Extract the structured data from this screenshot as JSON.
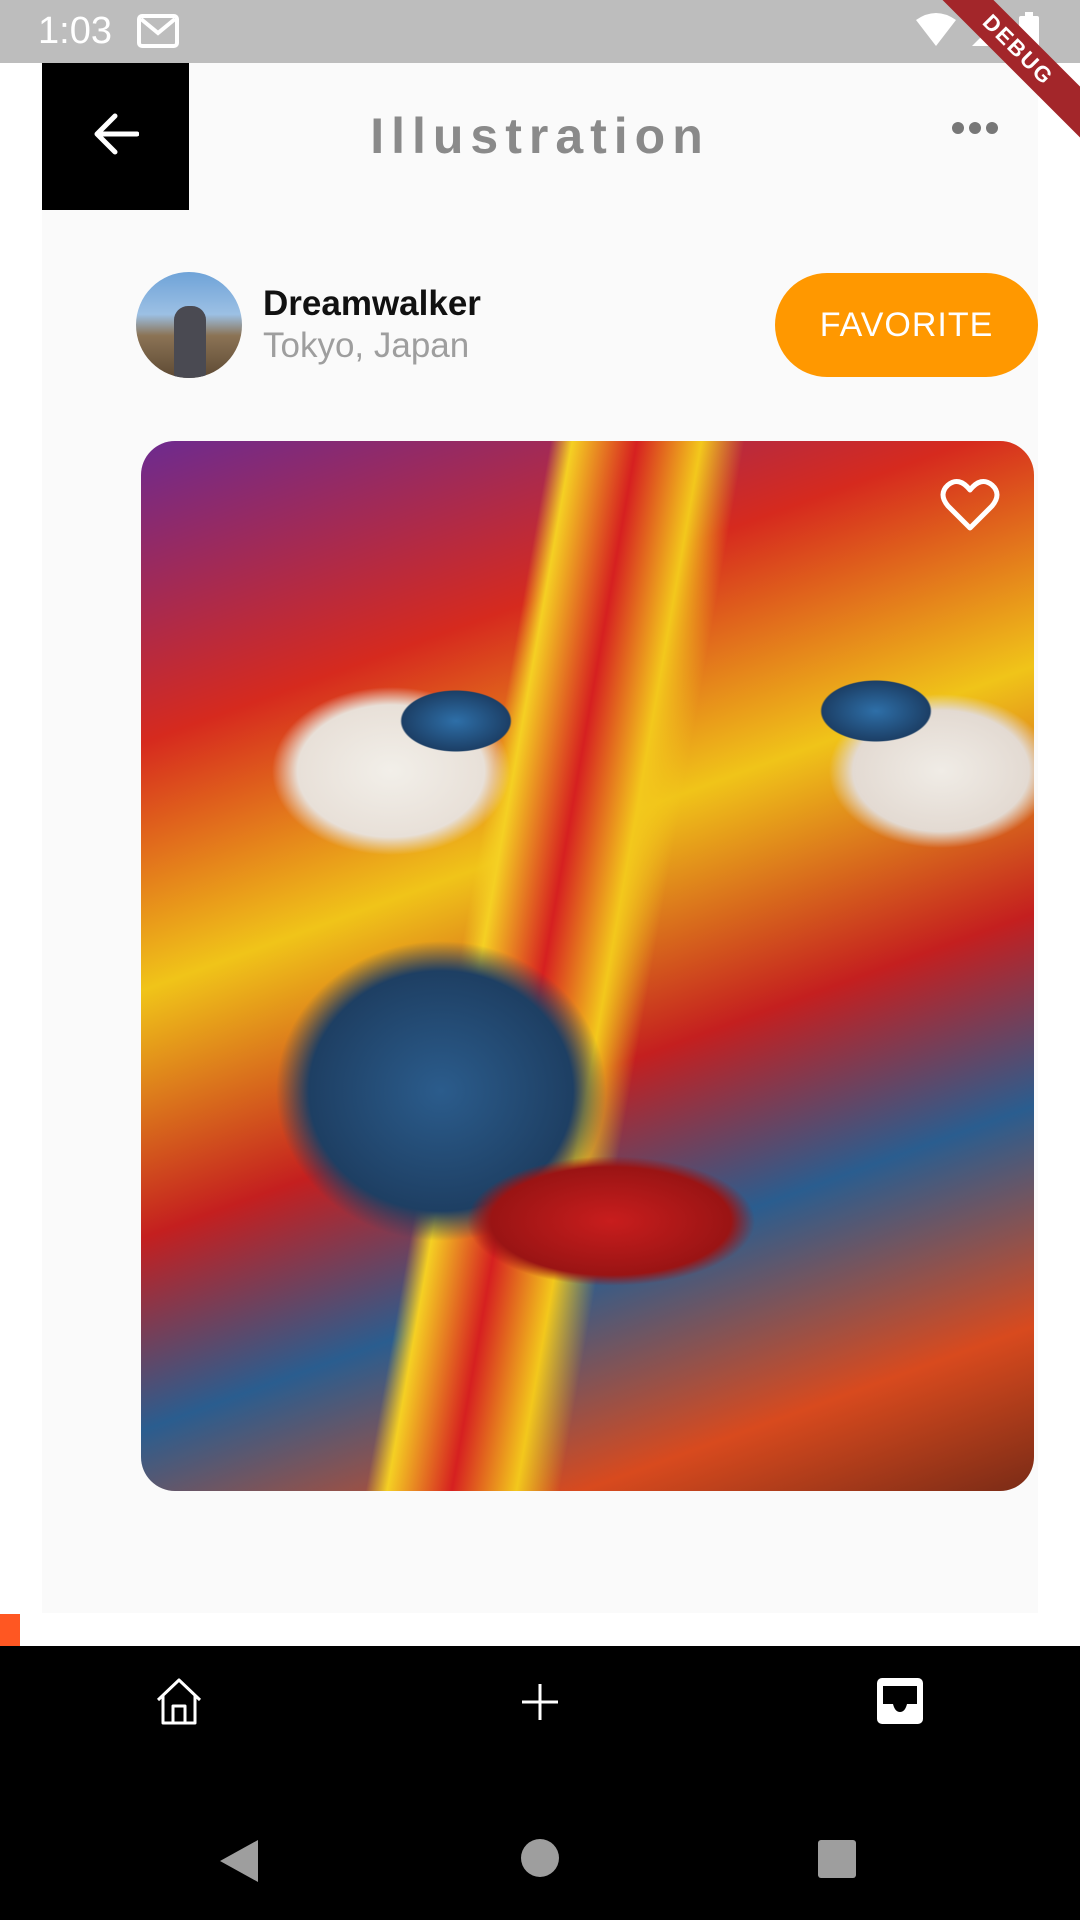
{
  "status_bar": {
    "time": "1:03",
    "icons": [
      "gmail-icon",
      "wifi-icon",
      "signal-icon",
      "battery-icon"
    ],
    "debug_label": "DEBUG"
  },
  "header": {
    "title": "Illustration",
    "back_icon": "arrow-left-icon",
    "more_icon": "more-horizontal-icon"
  },
  "author": {
    "name": "Dreamwalker",
    "location": "Tokyo, Japan",
    "favorite_label": "FAVORITE"
  },
  "artwork": {
    "like_icon": "heart-outline-icon"
  },
  "bottom_nav": {
    "items": [
      "home-icon",
      "add-icon",
      "inbox-icon"
    ]
  },
  "system_nav": {
    "items": [
      "back-triangle-icon",
      "home-circle-icon",
      "recents-square-icon"
    ]
  },
  "colors": {
    "accent": "#ff9800",
    "status_bar": "#bdbdbd",
    "debug_ribbon": "#a3262a"
  }
}
